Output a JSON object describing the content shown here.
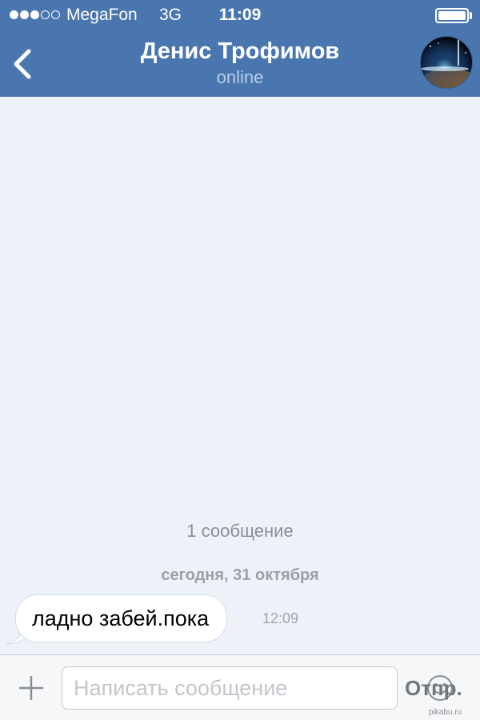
{
  "status_bar": {
    "carrier": "MegaFon",
    "network": "3G",
    "time": "11:09",
    "signal_bars_filled": 3,
    "signal_bars_total": 5,
    "battery_level": 1.0
  },
  "header": {
    "back_icon": "chevron-left-icon",
    "contact_name": "Денис Трофимов",
    "presence": "online",
    "avatar": "space-planet-avatar"
  },
  "feed": {
    "message_count": "1 сообщение",
    "date_separator": "сегодня, 31 октября",
    "messages": [
      {
        "text": "ладно забей.пока",
        "time": "12:09",
        "direction": "incoming"
      }
    ]
  },
  "composer": {
    "attach_icon": "plus-icon",
    "placeholder": "Написать сообщение",
    "emoji_icon": "smiley-icon",
    "send_label": "Отпр."
  },
  "watermark": "pikabu.ru",
  "colors": {
    "header_bg": "#4a76b0",
    "feed_bg": "#edf2f9",
    "bubble_bg": "#ffffff"
  }
}
